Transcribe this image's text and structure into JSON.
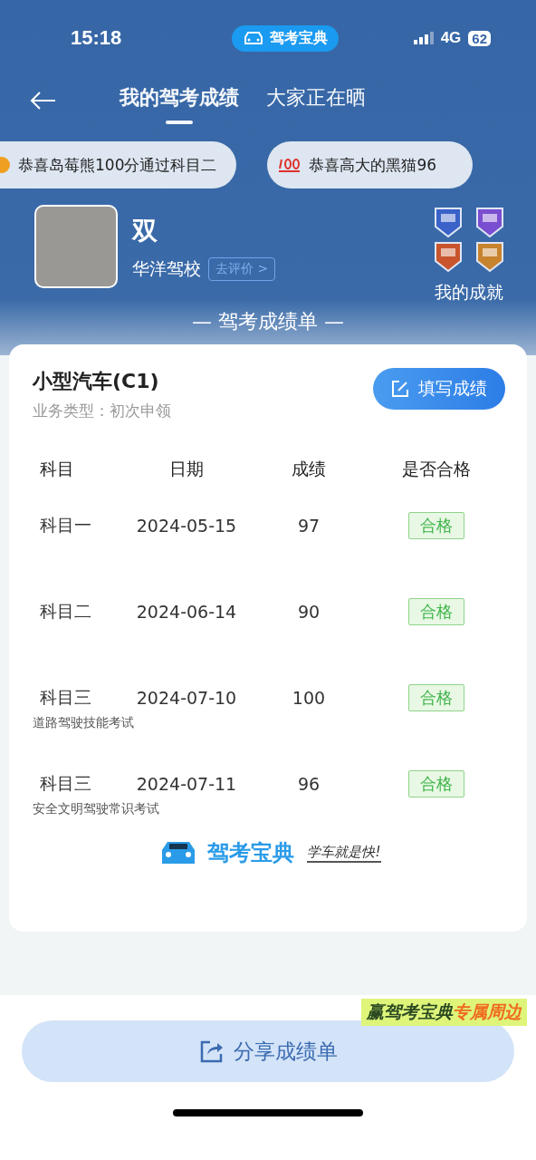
{
  "status_bar": {
    "time": "15:18",
    "app_pill": "驾考宝典",
    "network": "4G",
    "battery": "62"
  },
  "nav": {
    "tabs": [
      {
        "label": "我的驾考成绩",
        "selected": true
      },
      {
        "label": "大家正在晒",
        "selected": false
      }
    ]
  },
  "tickers": [
    {
      "text": "恭喜岛莓熊100分通过科目二"
    },
    {
      "text": "恭喜高大的黑猫96"
    }
  ],
  "profile": {
    "name": "双",
    "school": "华洋驾校",
    "review_button": "去评价 >",
    "achievements_label": "我的成就"
  },
  "section_title": "— 驾考成绩单 —",
  "card": {
    "vehicle": "小型汽车(C1)",
    "business_type": "业务类型：初次申领",
    "fill_button": "填写成绩",
    "columns": [
      "科目",
      "日期",
      "成绩",
      "是否合格"
    ],
    "rows": [
      {
        "subject": "科目一",
        "date": "2024-05-15",
        "score": "97",
        "result": "合格",
        "passed": true
      },
      {
        "subject": "科目二",
        "date": "2024-06-14",
        "score": "90",
        "result": "合格",
        "passed": true
      },
      {
        "subject": "科目三",
        "date": "2024-07-10",
        "score": "100",
        "result": "合格",
        "passed": true,
        "note": "道路驾驶技能考试"
      },
      {
        "subject": "科目三",
        "date": "2024-07-11",
        "score": "96",
        "result": "合格",
        "passed": true,
        "note": "安全文明驾驶常识考试"
      }
    ],
    "brand": "驾考宝典",
    "slogan": "学车就是快!"
  },
  "promo": {
    "text": "赢驾考宝典",
    "highlight": "专属周边"
  },
  "share_button": "分享成绩单"
}
